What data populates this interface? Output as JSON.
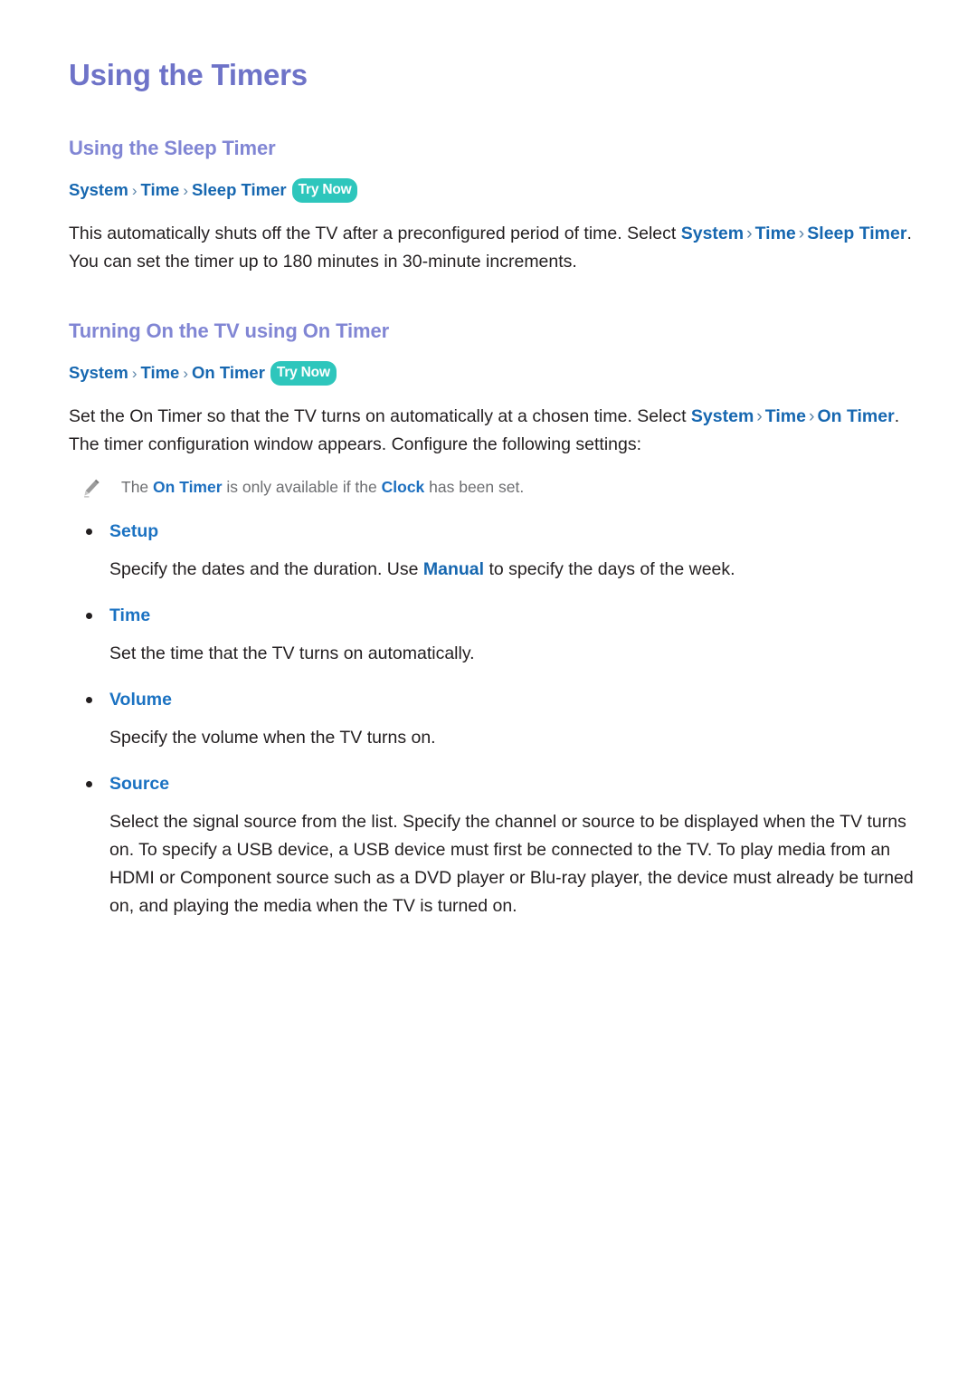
{
  "page": {
    "title": "Using the Timers",
    "background_color": "#ffffff",
    "heading_color": "#6e73c8",
    "subheading_color": "#8186d4",
    "link_color": "#1667b0",
    "badge_color": "#2ec6bc",
    "body_color": "#231f20",
    "note_color": "#6d6e71"
  },
  "sections": [
    {
      "heading": "Using the Sleep Timer",
      "breadcrumb": {
        "crumbs": [
          "System",
          "Time",
          "Sleep Timer"
        ],
        "separator": "›",
        "badge": "Try Now"
      },
      "paragraph": {
        "part1": "This automatically shuts off the TV after a preconfigured period of time. Select ",
        "kw1": "System",
        "sep1": "›",
        "kw2": "Time",
        "sep2": "›",
        "kw3": "Sleep Timer",
        "part2": ". You can set the timer up to 180 minutes in 30-minute increments."
      }
    },
    {
      "heading": "Turning On the TV using On Timer",
      "breadcrumb": {
        "crumbs": [
          "System",
          "Time",
          "On Timer"
        ],
        "separator": "›",
        "badge": "Try Now"
      },
      "paragraph": {
        "part1": "Set the On Timer so that the TV turns on automatically at a chosen time. Select ",
        "kw1": "System",
        "sep1": "›",
        "kw2": "Time",
        "sep2": "›",
        "kw3": "On Timer",
        "part2": ". The timer configuration window appears. Configure the following settings:"
      }
    }
  ],
  "note": {
    "icon": "pencil-icon",
    "text_before": "The ",
    "kw1": "On Timer",
    "text_middle": " is only available if the ",
    "kw2": "Clock",
    "text_after": " has been set."
  },
  "bullets": [
    {
      "label": "Setup",
      "desc_part1": "Specify the dates and the duration. Use ",
      "desc_kw": "Manual",
      "desc_part2": " to specify the days of the week."
    },
    {
      "label": "Time",
      "desc_part1": "Set the time that the TV turns on automatically.",
      "desc_kw": "",
      "desc_part2": ""
    },
    {
      "label": "Volume",
      "desc_part1": "Specify the volume when the TV turns on.",
      "desc_kw": "",
      "desc_part2": ""
    },
    {
      "label": "Source",
      "desc_part1": "Select the signal source from the list. Specify the channel or source to be displayed when the TV turns on. To specify a USB device, a USB device must first be connected to the TV. To play media from an HDMI or Component source such as a DVD player or Blu-ray player, the device must already be turned on, and playing the media when the TV is turned on.",
      "desc_kw": "",
      "desc_part2": ""
    }
  ]
}
